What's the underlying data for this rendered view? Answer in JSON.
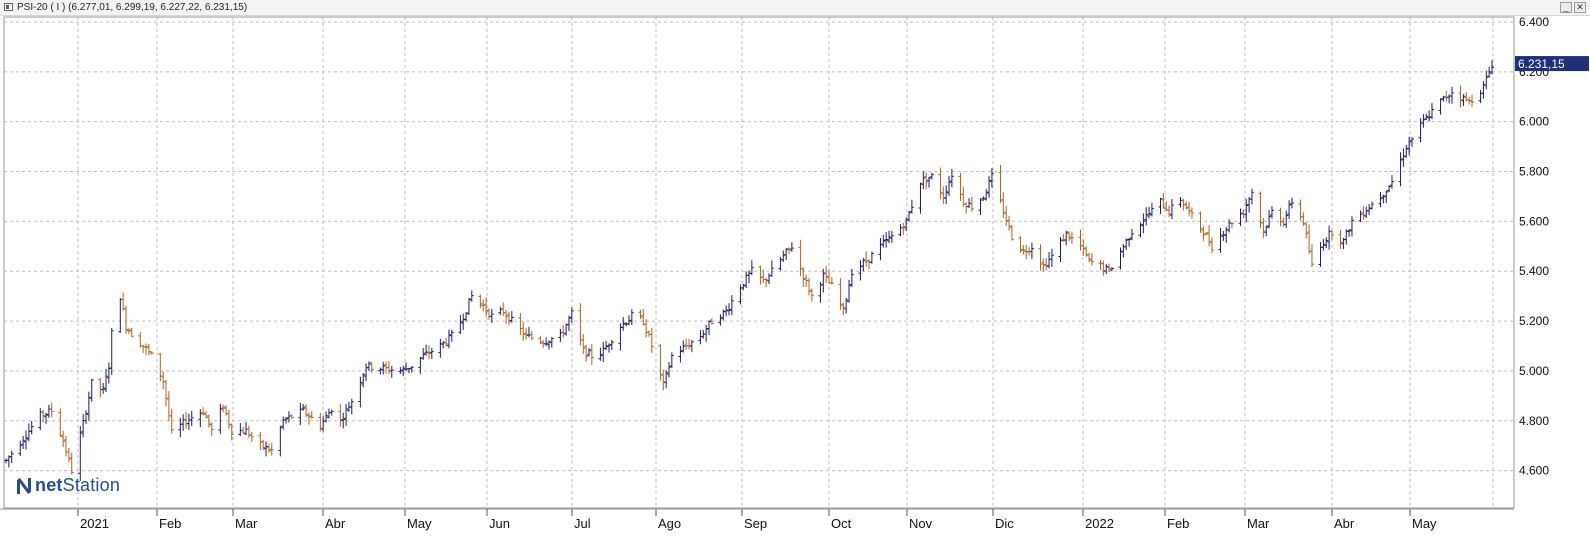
{
  "window": {
    "title": "PSI-20 ( I ) (6.277,01, 6.299,19, 6.227,22, 6.231,15)",
    "minimize_glyph": "_",
    "close_glyph": "✕"
  },
  "logo": {
    "text_bold": "N",
    "text_rest": "net",
    "text_brand": "Station",
    "icon": "netstation-n-icon"
  },
  "colors": {
    "up": "#1a1a66",
    "down": "#b06020",
    "grid": "#bdbdbd",
    "price_box": "#1f2f7a"
  },
  "chart_data": {
    "type": "ohlc",
    "title": "PSI-20 ( I )",
    "last_quote": {
      "open": 6277.01,
      "high": 6299.19,
      "low": 6227.22,
      "close": 6231.15
    },
    "current_price_label": "6.231,15",
    "y_axis": {
      "side": "right",
      "range": [
        4450,
        6420
      ],
      "ticks": [
        4600,
        4800,
        5000,
        5200,
        5400,
        5600,
        5800,
        6000,
        6200,
        6400
      ],
      "tick_labels": [
        "4.600",
        "4.800",
        "5.000",
        "5.200",
        "5.400",
        "5.600",
        "5.800",
        "6.000",
        "6.200",
        "6.400"
      ]
    },
    "x_axis": {
      "labels": [
        "2021",
        "Feb",
        "Mar",
        "Abr",
        "May",
        "Jun",
        "Jul",
        "Ago",
        "Sep",
        "Oct",
        "Nov",
        "Dic",
        "2022",
        "Feb",
        "Mar",
        "Abr",
        "May"
      ],
      "start_date": "2020-12-23",
      "end_date": "2022-05-27"
    },
    "grid": true,
    "price_path": [
      [
        "2020-12-23",
        4640
      ],
      [
        "2021-01-04",
        4820
      ],
      [
        "2021-01-08",
        4840
      ],
      [
        "2021-01-12",
        4720
      ],
      [
        "2021-01-15",
        4600
      ],
      [
        "2021-01-19",
        4790
      ],
      [
        "2021-01-22",
        4950
      ],
      [
        "2021-01-26",
        4920
      ],
      [
        "2021-01-28",
        5020
      ],
      [
        "2021-01-29",
        5150
      ],
      [
        "2021-02-01",
        5300
      ],
      [
        "2021-02-03",
        5180
      ],
      [
        "2021-02-05",
        5150
      ],
      [
        "2021-02-09",
        5100
      ],
      [
        "2021-02-12",
        5060
      ],
      [
        "2021-02-16",
        4960
      ],
      [
        "2021-02-19",
        4750
      ],
      [
        "2021-02-24",
        4800
      ],
      [
        "2021-03-02",
        4840
      ],
      [
        "2021-03-05",
        4760
      ],
      [
        "2021-03-09",
        4860
      ],
      [
        "2021-03-12",
        4760
      ],
      [
        "2021-03-17",
        4760
      ],
      [
        "2021-03-22",
        4700
      ],
      [
        "2021-03-26",
        4680
      ],
      [
        "2021-03-30",
        4800
      ],
      [
        "2021-04-06",
        4840
      ],
      [
        "2021-04-12",
        4780
      ],
      [
        "2021-04-16",
        4850
      ],
      [
        "2021-04-19",
        4800
      ],
      [
        "2021-04-23",
        4880
      ],
      [
        "2021-04-28",
        5020
      ],
      [
        "2021-05-04",
        5010
      ],
      [
        "2021-05-10",
        5000
      ],
      [
        "2021-05-14",
        5020
      ],
      [
        "2021-05-18",
        5060
      ],
      [
        "2021-05-24",
        5100
      ],
      [
        "2021-05-28",
        5140
      ],
      [
        "2021-06-01",
        5220
      ],
      [
        "2021-06-04",
        5300
      ],
      [
        "2021-06-08",
        5260
      ],
      [
        "2021-06-11",
        5220
      ],
      [
        "2021-06-15",
        5240
      ],
      [
        "2021-06-18",
        5200
      ],
      [
        "2021-06-23",
        5140
      ],
      [
        "2021-06-29",
        5120
      ],
      [
        "2021-07-05",
        5140
      ],
      [
        "2021-07-09",
        5230
      ],
      [
        "2021-07-13",
        5080
      ],
      [
        "2021-07-16",
        5060
      ],
      [
        "2021-07-20",
        5080
      ],
      [
        "2021-07-26",
        5180
      ],
      [
        "2021-07-30",
        5220
      ],
      [
        "2021-08-03",
        5200
      ],
      [
        "2021-08-06",
        5100
      ],
      [
        "2021-08-10",
        4940
      ],
      [
        "2021-08-13",
        5060
      ],
      [
        "2021-08-18",
        5100
      ],
      [
        "2021-08-23",
        5140
      ],
      [
        "2021-08-27",
        5200
      ],
      [
        "2021-09-01",
        5240
      ],
      [
        "2021-09-06",
        5340
      ],
      [
        "2021-09-10",
        5400
      ],
      [
        "2021-09-14",
        5360
      ],
      [
        "2021-09-17",
        5400
      ],
      [
        "2021-09-21",
        5460
      ],
      [
        "2021-09-24",
        5500
      ],
      [
        "2021-09-28",
        5380
      ],
      [
        "2021-10-01",
        5300
      ],
      [
        "2021-10-05",
        5380
      ],
      [
        "2021-10-08",
        5340
      ],
      [
        "2021-10-12",
        5240
      ],
      [
        "2021-10-15",
        5400
      ],
      [
        "2021-10-20",
        5440
      ],
      [
        "2021-10-25",
        5500
      ],
      [
        "2021-10-29",
        5540
      ],
      [
        "2021-11-03",
        5600
      ],
      [
        "2021-11-08",
        5760
      ],
      [
        "2021-11-12",
        5780
      ],
      [
        "2021-11-16",
        5700
      ],
      [
        "2021-11-19",
        5790
      ],
      [
        "2021-11-23",
        5680
      ],
      [
        "2021-11-26",
        5660
      ],
      [
        "2021-11-30",
        5700
      ],
      [
        "2021-12-03",
        5780
      ],
      [
        "2021-12-07",
        5640
      ],
      [
        "2021-12-10",
        5540
      ],
      [
        "2021-12-14",
        5480
      ],
      [
        "2021-12-17",
        5500
      ],
      [
        "2021-12-21",
        5420
      ],
      [
        "2021-12-24",
        5460
      ],
      [
        "2021-12-29",
        5550
      ],
      [
        "2022-01-03",
        5500
      ],
      [
        "2022-01-06",
        5440
      ],
      [
        "2022-01-10",
        5420
      ],
      [
        "2022-01-13",
        5400
      ],
      [
        "2022-01-18",
        5500
      ],
      [
        "2022-01-21",
        5560
      ],
      [
        "2022-01-26",
        5620
      ],
      [
        "2022-01-31",
        5680
      ],
      [
        "2022-02-03",
        5640
      ],
      [
        "2022-02-07",
        5690
      ],
      [
        "2022-02-11",
        5620
      ],
      [
        "2022-02-15",
        5560
      ],
      [
        "2022-02-18",
        5500
      ],
      [
        "2022-02-22",
        5560
      ],
      [
        "2022-02-25",
        5600
      ],
      [
        "2022-03-01",
        5640
      ],
      [
        "2022-03-04",
        5720
      ],
      [
        "2022-03-08",
        5560
      ],
      [
        "2022-03-11",
        5640
      ],
      [
        "2022-03-15",
        5600
      ],
      [
        "2022-03-18",
        5680
      ],
      [
        "2022-03-22",
        5600
      ],
      [
        "2022-03-25",
        5420
      ],
      [
        "2022-03-29",
        5520
      ],
      [
        "2022-04-01",
        5560
      ],
      [
        "2022-04-05",
        5520
      ],
      [
        "2022-04-08",
        5600
      ],
      [
        "2022-04-12",
        5640
      ],
      [
        "2022-04-18",
        5700
      ],
      [
        "2022-04-22",
        5760
      ],
      [
        "2022-04-27",
        5900
      ],
      [
        "2022-05-03",
        6000
      ],
      [
        "2022-05-09",
        6080
      ],
      [
        "2022-05-13",
        6120
      ],
      [
        "2022-05-19",
        6080
      ],
      [
        "2022-05-24",
        6140
      ],
      [
        "2022-05-27",
        6231
      ]
    ]
  }
}
